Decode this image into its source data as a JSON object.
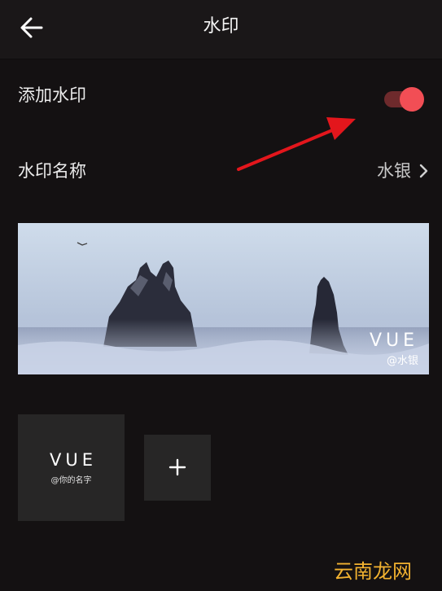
{
  "header": {
    "title": "水印",
    "back_icon": "arrow-left-icon"
  },
  "settings": {
    "add_watermark_label": "添加水印",
    "add_watermark_enabled": true,
    "watermark_name_label": "水印名称",
    "watermark_name_value": "水银",
    "chevron_icon": "chevron-right-icon"
  },
  "preview": {
    "watermark_title": "VUE",
    "watermark_subtitle": "@水银"
  },
  "templates": [
    {
      "title": "VUE",
      "subtitle": "@你的名字"
    }
  ],
  "add_button_icon": "plus-icon",
  "site_watermark": "云南龙网",
  "colors": {
    "background": "#141112",
    "header": "#1a1718",
    "accent": "#f24e55",
    "tile": "#272626",
    "annotation_arrow": "#e3161c",
    "site_watermark": "#f2b230"
  }
}
